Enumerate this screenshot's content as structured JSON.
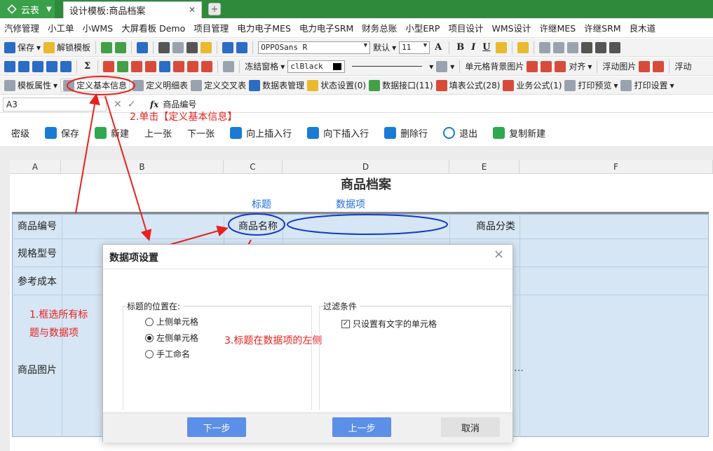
{
  "tabs": {
    "app_name": "云表",
    "doc_tab": "设计模板:商品档案",
    "close_glyph": "✕",
    "new_tab_glyph": "+"
  },
  "menu": [
    "汽修管理",
    "小工单",
    "小WMS",
    "大屏看板 Demo",
    "项目管理",
    "电力电子MES",
    "电力电子SRM",
    "财务总账",
    "小型ERP",
    "项目设计",
    "WMS设计",
    "许继MES",
    "许继SRM",
    "良木道"
  ],
  "toolbar1": {
    "save": "保存",
    "unlock_template": "解锁模板",
    "font_name": "OPPOSans R",
    "font_default": "默认",
    "font_size": "11"
  },
  "toolbar2": {
    "freeze": "冻结窗格",
    "color_name": "clBlack",
    "cell_bg_image": "单元格背景图片",
    "align": "对齐",
    "float_image": "浮动图片",
    "float_more": "浮动"
  },
  "toolbar3": {
    "template_props": "模板属性",
    "define_basic": "定义基本信息",
    "define_detail": "定义明细表",
    "define_cross": "定义交叉表",
    "table_mgmt": "数据表管理",
    "status_settings": "状态设置(0)",
    "data_interface": "数据接口(11)",
    "fill_formula": "填表公式(28)",
    "business_formula": "业务公式(1)",
    "print_preview": "打印预览",
    "print_settings": "打印设置"
  },
  "formula_bar": {
    "cell_ref": "A3",
    "fx_label": "fx",
    "value": "商品编号"
  },
  "actions": [
    "密级",
    "保存",
    "新建",
    "上一张",
    "下一张",
    "向上插入行",
    "向下插入行",
    "删除行",
    "退出",
    "复制新建"
  ],
  "sheet": {
    "columns": [
      "A",
      "B",
      "C",
      "D",
      "E",
      "F"
    ],
    "title": "商品档案",
    "row_labels": {
      "product_no": "商品编号",
      "product_name": "商品名称",
      "category": "商品分类",
      "spec": "规格型号",
      "ref_cost": "参考成本",
      "image": "商品图片"
    }
  },
  "annotations": {
    "step1_line1": "1.框选所有标",
    "step1_line2": "题与数据项",
    "step2": "2.单击【定义基本信息】",
    "step3": "3.标题在数据项的左侧",
    "title_tag": "标题",
    "data_item_tag": "数据项",
    "colors": {
      "red": "#e8211e",
      "blue": "#1f6fe0"
    }
  },
  "dialog": {
    "title": "数据项设置",
    "position_group": "标题的位置在:",
    "options": [
      "上侧单元格",
      "左侧单元格",
      "手工命名"
    ],
    "selected": "左侧单元格",
    "filter_group": "过滤条件",
    "filter_option": "只设置有文字的单元格",
    "filter_checked": true,
    "buttons": {
      "next": "下一步",
      "prev": "上一步",
      "cancel": "取消"
    }
  }
}
